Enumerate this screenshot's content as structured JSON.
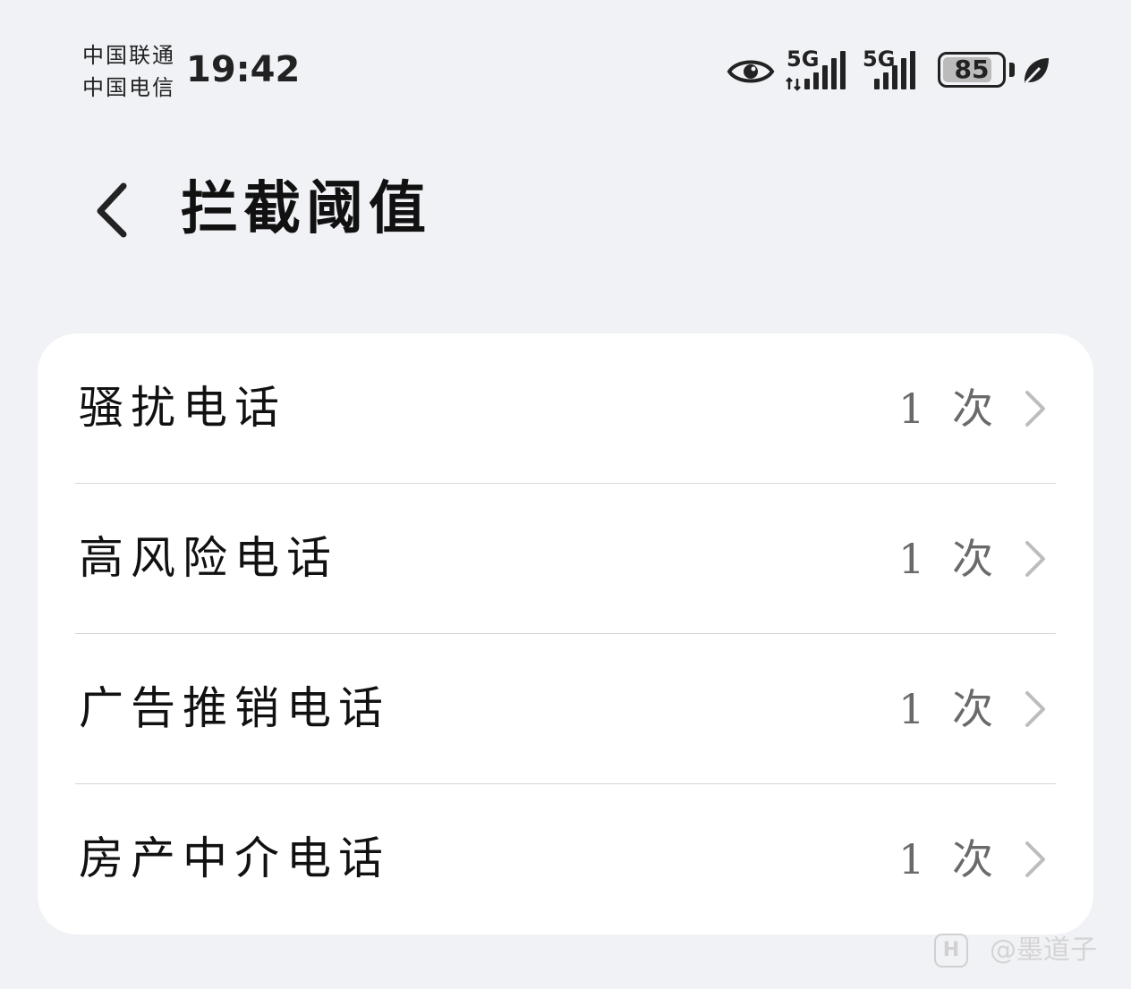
{
  "status_bar": {
    "carrier_1": "中国联通",
    "carrier_2": "中国电信",
    "time": "19:42",
    "icons": [
      "eye-icon",
      "signal-5g-1-icon",
      "signal-5g-2-icon",
      "battery-icon",
      "leaf-icon"
    ],
    "network_1": "5G",
    "network_2": "5G",
    "battery_level": 85,
    "battery_text": "85"
  },
  "header": {
    "back_icon": "chevron-left-icon",
    "title": "拦截阈值"
  },
  "items": [
    {
      "label": "骚扰电话",
      "value": "1 次"
    },
    {
      "label": "高风险电话",
      "value": "1 次"
    },
    {
      "label": "广告推销电话",
      "value": "1 次"
    },
    {
      "label": "房产中介电话",
      "value": "1 次"
    }
  ],
  "watermark": {
    "logo": "H",
    "text": "@墨道子"
  },
  "colors": {
    "background": "#f1f2f6",
    "card": "#ffffff",
    "text": "#111111",
    "value_text": "#6a6a6a",
    "chevron": "#bdbdbd",
    "divider": "#d6d6d6"
  }
}
